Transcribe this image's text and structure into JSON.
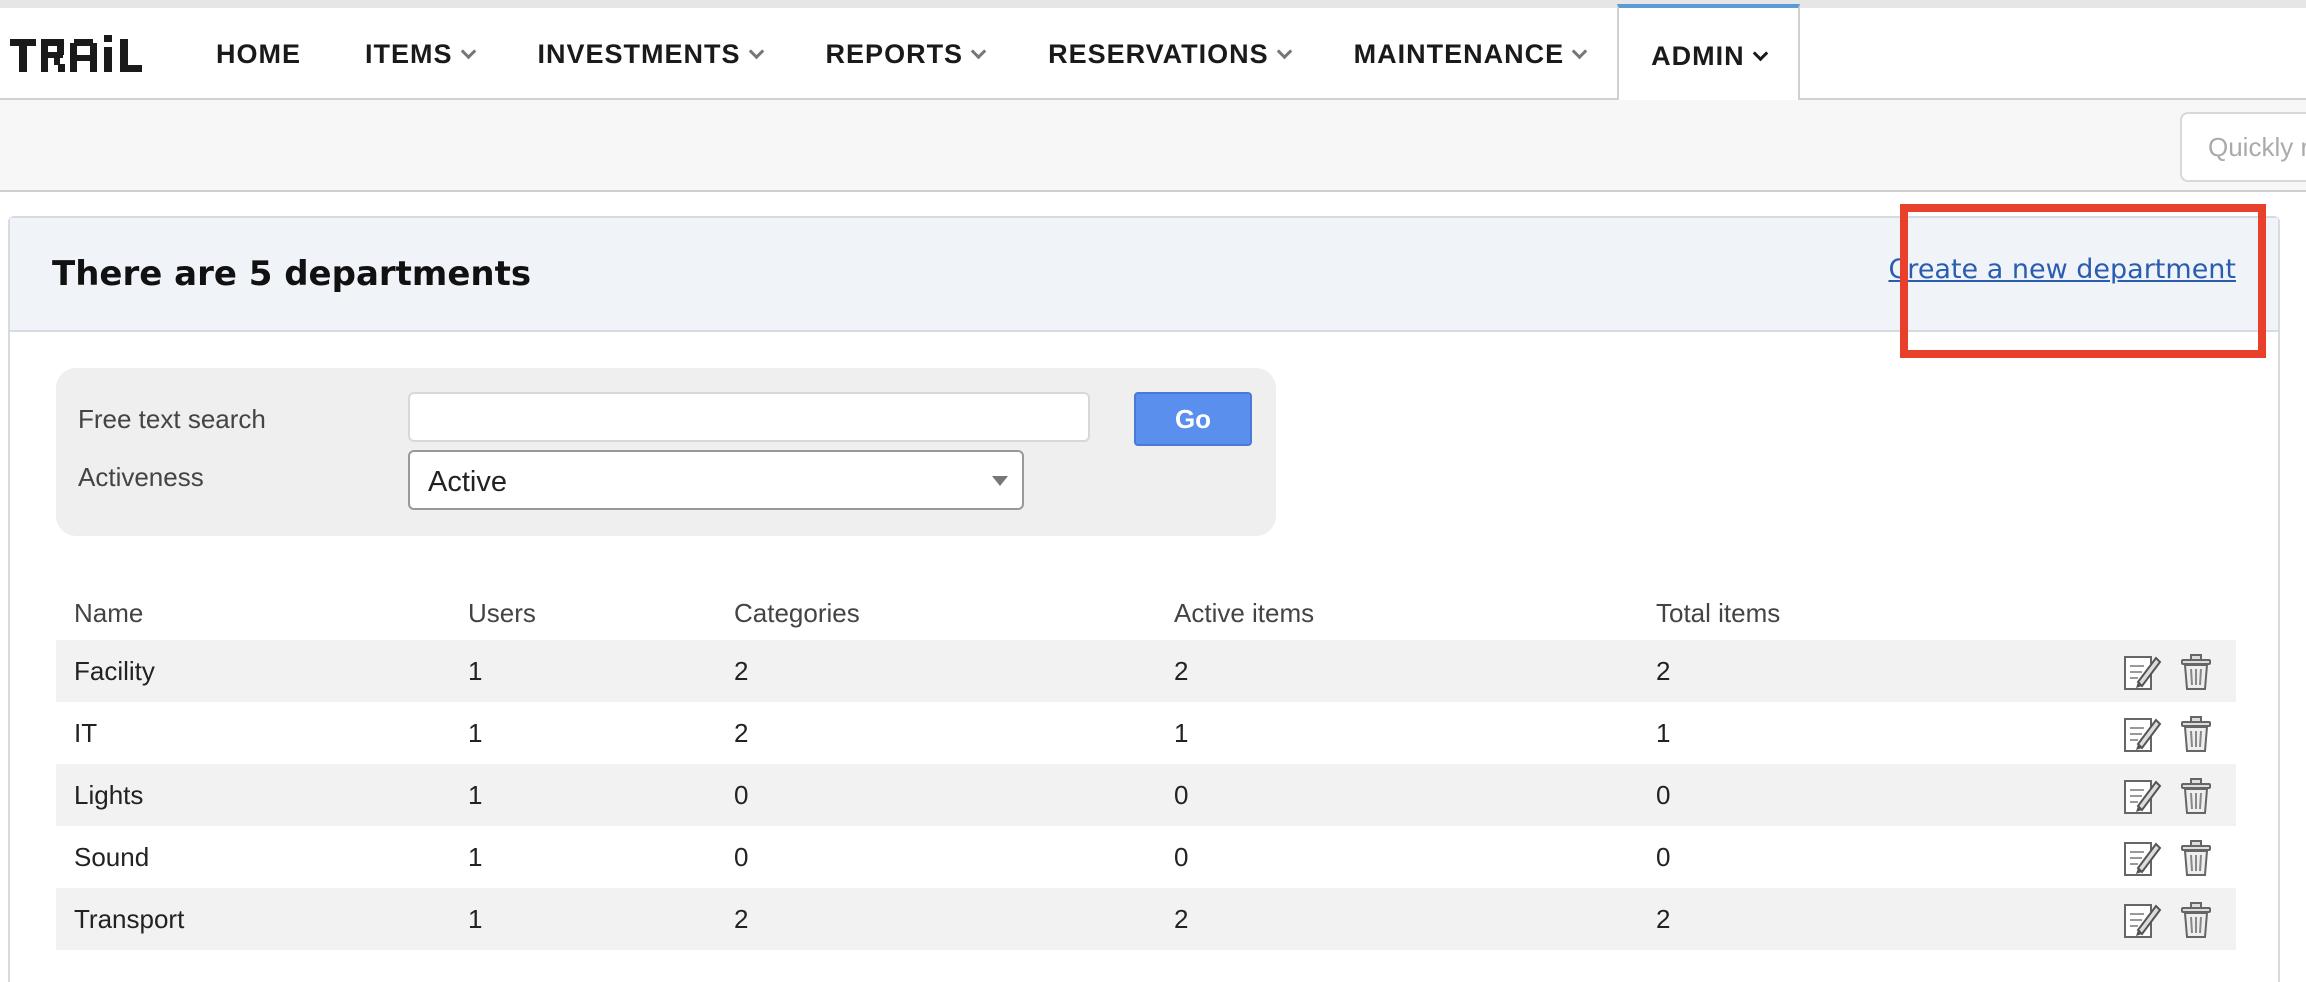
{
  "brand": {
    "logo_text": "TRAIL"
  },
  "nav": {
    "items": [
      {
        "label": "HOME",
        "dropdown": false
      },
      {
        "label": "ITEMS",
        "dropdown": true
      },
      {
        "label": "INVESTMENTS",
        "dropdown": true
      },
      {
        "label": "REPORTS",
        "dropdown": true
      },
      {
        "label": "RESERVATIONS",
        "dropdown": true
      },
      {
        "label": "MAINTENANCE",
        "dropdown": true
      },
      {
        "label": "ADMIN",
        "dropdown": true,
        "active": true
      }
    ]
  },
  "subbar": {
    "quick_search_placeholder": "Quickly r"
  },
  "panel": {
    "title": "There are 5 departments",
    "create_link": "Create a new department"
  },
  "filter": {
    "free_text_label": "Free text search",
    "free_text_value": "",
    "go_label": "Go",
    "activeness_label": "Activeness",
    "activeness_value": "Active"
  },
  "table": {
    "headers": [
      "Name",
      "Users",
      "Categories",
      "Active items",
      "Total items"
    ],
    "rows": [
      [
        "Facility",
        "1",
        "2",
        "2",
        "2"
      ],
      [
        "IT",
        "1",
        "2",
        "1",
        "1"
      ],
      [
        "Lights",
        "1",
        "0",
        "0",
        "0"
      ],
      [
        "Sound",
        "1",
        "0",
        "0",
        "0"
      ],
      [
        "Transport",
        "1",
        "2",
        "2",
        "2"
      ]
    ],
    "row_actions": [
      "edit-icon",
      "trash-icon"
    ]
  },
  "colors": {
    "accent": "#5b9bd5",
    "link": "#2a5db0",
    "go_button": "#5b8fee",
    "highlight": "#e8402a",
    "panel_header_bg": "#f0f4f9"
  }
}
